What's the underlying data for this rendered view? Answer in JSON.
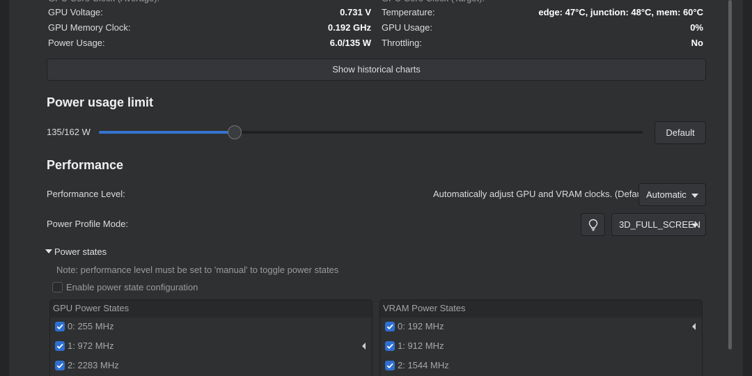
{
  "stats": {
    "rows": [
      {
        "left_label": "GPU Voltage:",
        "left_value": "0.731 V",
        "right_label": "Temperature:",
        "right_value": "edge: 47°C, junction: 48°C, mem: 60°C"
      },
      {
        "left_label": "GPU Memory Clock:",
        "left_value": "0.192 GHz",
        "right_label": "GPU Usage:",
        "right_value": "0%"
      },
      {
        "left_label": "Power Usage:",
        "left_value": "6.0/135 W",
        "right_label": "Throttling:",
        "right_value": "No"
      }
    ],
    "historical_button": "Show historical charts"
  },
  "power_limit": {
    "title": "Power usage limit",
    "value_label": "135/162 W",
    "current_w": 135,
    "max_w": 162,
    "slider_fraction": 0.25,
    "default_button": "Default"
  },
  "performance": {
    "title": "Performance",
    "level_label": "Performance Level:",
    "level_description": "Automatically adjust GPU and VRAM clocks. (Default)",
    "level_selected": "Automatic",
    "profile_label": "Power Profile Mode:",
    "profile_icon": "lightbulb-icon",
    "profile_selected": "3D_FULL_SCREEN"
  },
  "power_states": {
    "expander_label": "Power states",
    "note": "Note: performance level must be set to 'manual' to toggle power states",
    "enable_label": "Enable power state configuration",
    "gpu": {
      "title": "GPU Power States",
      "items": [
        "0: 255 MHz",
        "1: 972 MHz",
        "2: 2283 MHz"
      ]
    },
    "vram": {
      "title": "VRAM Power States",
      "items": [
        "0: 192 MHz",
        "1: 912 MHz",
        "2: 1544 MHz"
      ]
    }
  },
  "colors": {
    "accent": "#3574d0",
    "background": "#2f3032"
  }
}
